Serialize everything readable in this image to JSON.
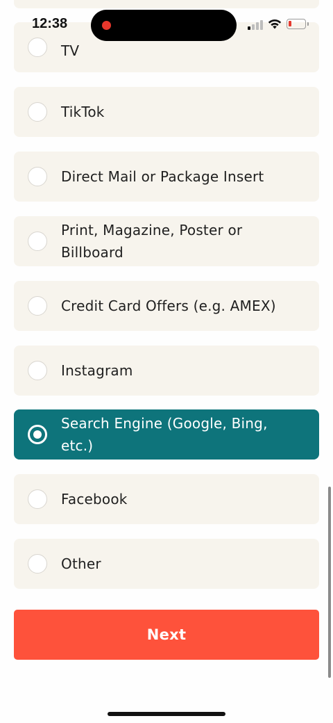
{
  "status_bar": {
    "time": "12:38",
    "battery_level_percent": 10,
    "recording_indicator_color": "#e7372c"
  },
  "options": [
    {
      "label": "",
      "selected": false
    },
    {
      "label": "TV",
      "selected": false
    },
    {
      "label": "TikTok",
      "selected": false
    },
    {
      "label": "Direct Mail or Package Insert",
      "selected": false
    },
    {
      "label": "Print, Magazine, Poster or Billboard",
      "selected": false
    },
    {
      "label": "Credit Card Offers (e.g. AMEX)",
      "selected": false
    },
    {
      "label": "Instagram",
      "selected": false
    },
    {
      "label": "Search Engine (Google, Bing, etc.)",
      "selected": true
    },
    {
      "label": "Facebook",
      "selected": false
    },
    {
      "label": "Other",
      "selected": false
    }
  ],
  "next_button": {
    "label": "Next"
  },
  "colors": {
    "option_background": "#f7f4ed",
    "selected_background": "#0e747b",
    "next_button": "#fe523b"
  }
}
